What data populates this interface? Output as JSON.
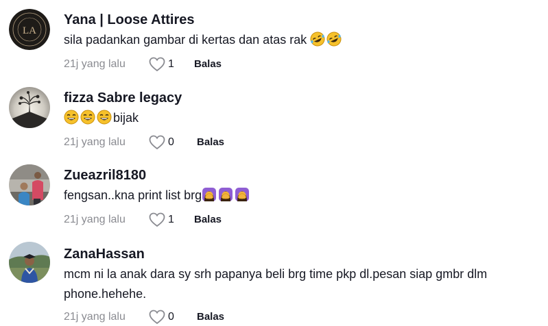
{
  "comments": [
    {
      "username": "Yana | Loose Attires",
      "text": "sila padankan gambar di kertas dan atas rak",
      "emojis": [
        "rofl-emoji",
        "rofl-emoji"
      ],
      "time": "21j yang lalu",
      "likes": "1",
      "reply_label": "Balas"
    },
    {
      "username": "fizza Sabre legacy",
      "text": "bijak",
      "emojis": [
        "laughing-emoji",
        "laughing-emoji",
        "laughing-emoji"
      ],
      "time": "21j yang lalu",
      "likes": "0",
      "reply_label": "Balas"
    },
    {
      "username": "Zueazril8180",
      "text": "fengsan..kna print list brg",
      "emojis": [
        "facepalm-emoji",
        "facepalm-emoji",
        "facepalm-emoji"
      ],
      "time": "21j yang lalu",
      "likes": "1",
      "reply_label": "Balas"
    },
    {
      "username": "ZanaHassan",
      "text_line1": "mcm ni la anak dara sy srh papanya beli brg time pkp dl.pesan siap gmbr dlm",
      "text_line2": "phone.hehehe.",
      "time": "21j yang lalu",
      "likes": "0",
      "reply_label": "Balas"
    }
  ],
  "avatar_logo_text": "LA",
  "colors": {
    "text": "#161823",
    "muted": "#8a8b91",
    "heart_outline": "#8a8b91"
  }
}
